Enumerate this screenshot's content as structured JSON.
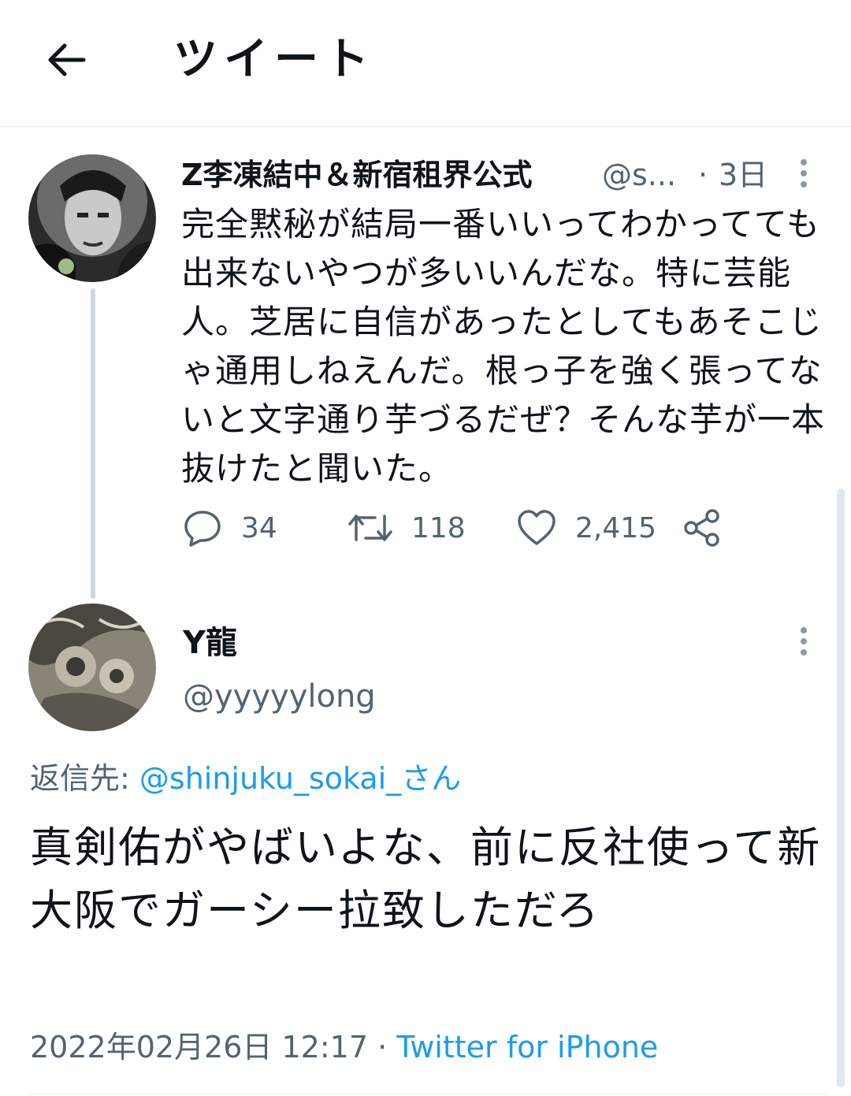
{
  "header": {
    "title": "ツイート",
    "back_icon": "arrow-left-icon"
  },
  "tweet1": {
    "display_name": "Z李凍結中＆新宿租界公式",
    "handle": "@s...",
    "separator": "·",
    "time": "3日",
    "text": "完全黙秘が結局一番いいってわかってても出来ないやつが多いいんだな。特に芸能人。芝居に自信があったとしてもあそこじゃ通用しねえんだ。根っ子を強く張ってないと文字通り芋づるだぜ？そんな芋が一本抜けたと聞いた。",
    "stats": {
      "replies": "34",
      "retweets": "118",
      "likes": "2,415"
    }
  },
  "tweet2": {
    "display_name": "Y龍",
    "handle": "@yyyyylong",
    "reply_prefix": "返信先: ",
    "reply_target": "@shinjuku_sokai_さん",
    "text": "真剣佑がやばいよな、前に反社使って新大阪でガーシー拉致しただろ",
    "timestamp": "2022年02月26日 12:17",
    "separator": " · ",
    "source": "Twitter for iPhone"
  },
  "colors": {
    "accent": "#1d9bf0",
    "secondary_text": "#536471",
    "text": "#0f1419",
    "divider": "#e6ecf0"
  }
}
